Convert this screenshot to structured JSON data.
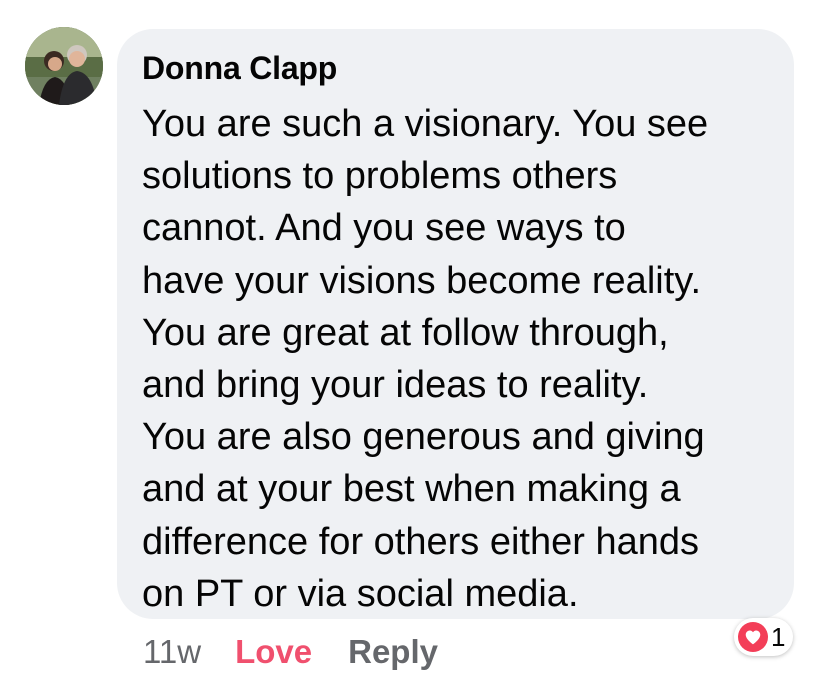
{
  "comment": {
    "author": "Donna Clapp",
    "text": "You are such a visionary. You see\nsolutions to problems others\ncannot. And you see ways to\nhave your visions become reality.\nYou are great at follow through,\nand bring your ideas to reality.\nYou are also generous and giving\nand at your best when making a\ndifference for others either hands\non PT or via social media.",
    "timestamp": "11w",
    "love_label": "Love",
    "reply_label": "Reply",
    "reaction_icon": "heart-icon",
    "reaction_count": "1"
  },
  "colors": {
    "bubble_bg": "#eff1f4",
    "love_active": "#f0506e",
    "meta_gray": "#65676b",
    "heart_badge": "#f33e58"
  }
}
